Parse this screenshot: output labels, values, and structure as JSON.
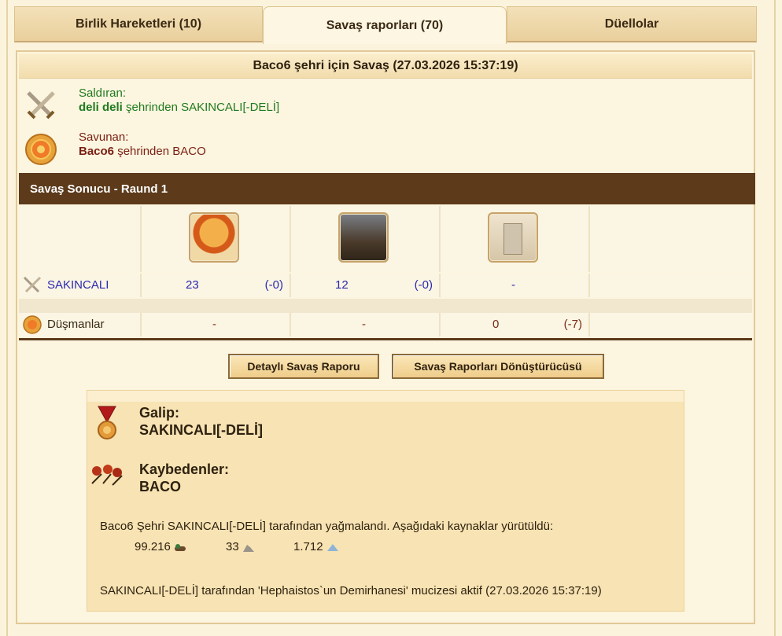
{
  "tabs": [
    {
      "label": "Birlik Hareketleri (10)"
    },
    {
      "label": "Savaş raporları (70)"
    },
    {
      "label": "Düellolar"
    }
  ],
  "report": {
    "title": "Baco6 şehri için Savaş (27.03.2026 15:37:19)",
    "attacker": {
      "label": "Saldıran:",
      "city": "deli deli",
      "rest": " şehrinden SAKINCALI[-DELİ]"
    },
    "defender": {
      "label": "Savunan:",
      "city": "Baco6",
      "rest": " şehrinden BACO"
    }
  },
  "round": {
    "title": "Savaş Sonucu - Raund 1"
  },
  "units": [
    {
      "icon": "hoplite-unit-icon"
    },
    {
      "icon": "catapult-unit-icon"
    },
    {
      "icon": "city-wall-icon"
    }
  ],
  "rows": {
    "attacker": {
      "name": "SAKINCALI",
      "c1a": "23",
      "c1b": "(-0)",
      "c2a": "12",
      "c2b": "(-0)",
      "c3a": "-"
    },
    "enemies": {
      "name": "Düşmanlar",
      "c1a": "-",
      "c2a": "-",
      "c3a": "0",
      "c3b": "(-7)"
    }
  },
  "buttons": {
    "detail": "Detaylı Savaş Raporu",
    "converter": "Savaş Raporları Dönüştürücüsü"
  },
  "result": {
    "winner_label": "Galip:",
    "winner": "SAKINCALI[-DELİ]",
    "loser_label": "Kaybedenler:",
    "loser": "BACO",
    "plunder_text": "Baco6 Şehri SAKINCALI[-DELİ] tarafından yağmalandı. Aşağıdaki kaynaklar yürütüldü:",
    "resources": [
      {
        "amount": "99.216",
        "icon": "wood-icon"
      },
      {
        "amount": "33",
        "icon": "stone-icon"
      },
      {
        "amount": "1.712",
        "icon": "iron-icon"
      }
    ],
    "wonder_text": "SAKINCALI[-DELİ] tarafından 'Hephaistos`un Demirhanesi' mucizesi aktif (27.03.2026 15:37:19)"
  },
  "colors": {
    "round_bar": "#5c3a1a",
    "attacker": "#1f7a1f",
    "defender": "#7a1f14",
    "link": "#2a2ab0"
  }
}
